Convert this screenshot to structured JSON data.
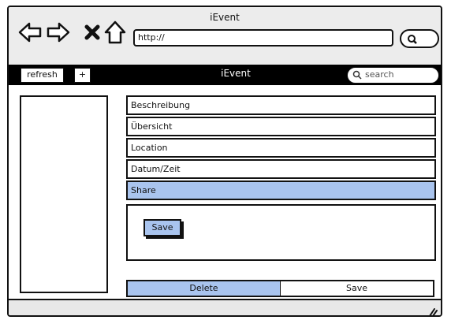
{
  "window": {
    "title": "iEvent"
  },
  "browser": {
    "url": "http://",
    "icons": [
      "back-arrow-icon",
      "forward-arrow-icon",
      "close-x-icon",
      "home-icon",
      "search-go-icon"
    ]
  },
  "toolbar": {
    "refresh_label": "refresh",
    "add_label": "+",
    "title": "iEvent",
    "search_placeholder": "search"
  },
  "menu": {
    "items": [
      {
        "label": "Beschreibung",
        "selected": false
      },
      {
        "label": "Übersicht",
        "selected": false
      },
      {
        "label": "Location",
        "selected": false
      },
      {
        "label": "Datum/Zeit",
        "selected": false
      },
      {
        "label": "Share",
        "selected": true
      }
    ]
  },
  "share_panel": {
    "save_label": "Save"
  },
  "actions": {
    "delete_label": "Delete",
    "save_label": "Save"
  },
  "colors": {
    "accent": "#a9c4ee",
    "toolbar": "#000000",
    "chrome": "#ececec"
  }
}
